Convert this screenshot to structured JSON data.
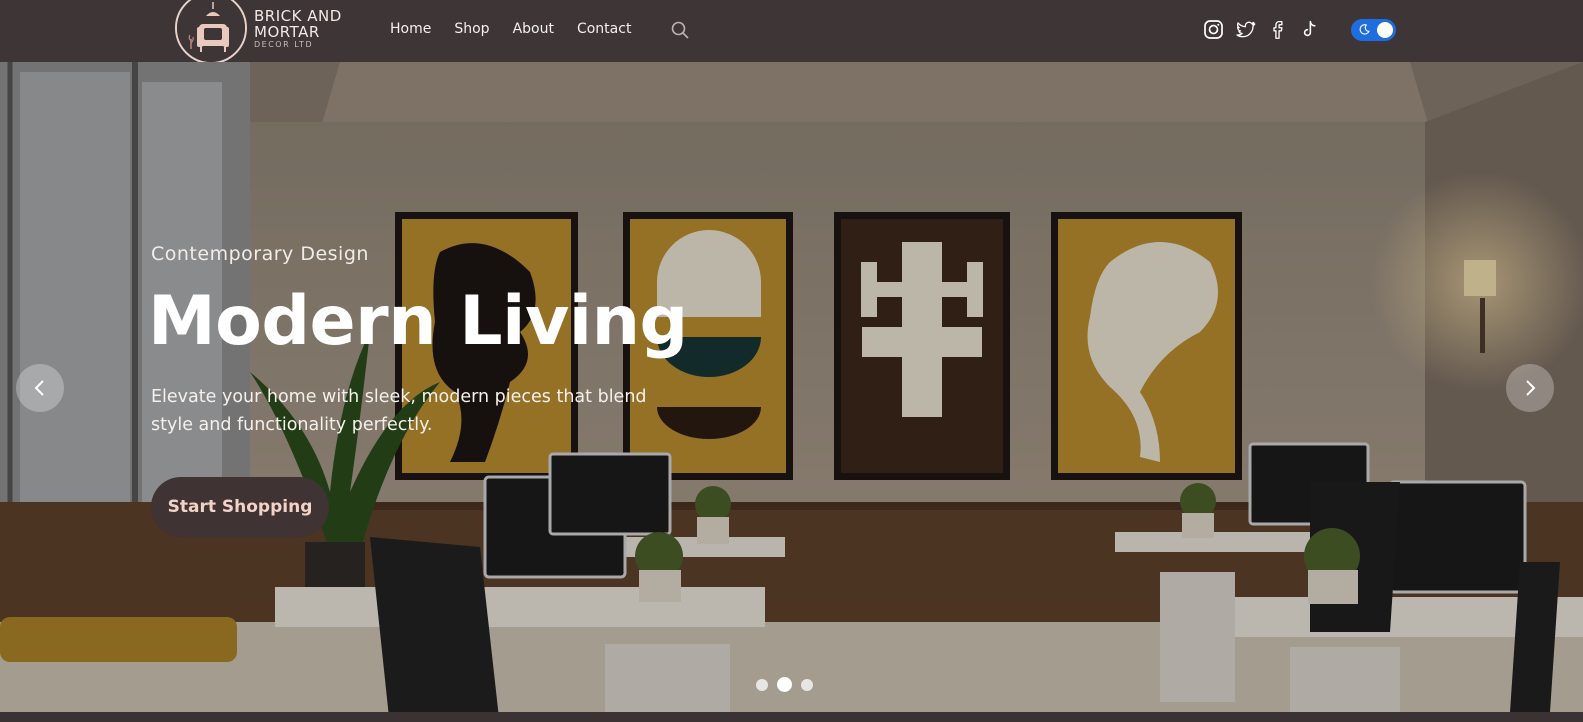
{
  "brand": {
    "line1": "BRICK AND",
    "line2": "MORTAR",
    "line3": "DECOR LTD"
  },
  "nav": {
    "links": [
      {
        "label": "Home"
      },
      {
        "label": "Shop"
      },
      {
        "label": "About"
      },
      {
        "label": "Contact"
      }
    ],
    "search_icon": "search-icon"
  },
  "social": [
    "instagram-icon",
    "twitter-icon",
    "facebook-icon",
    "tiktok-icon"
  ],
  "theme_toggle": {
    "state": "on",
    "icon": "moon-icon",
    "color": "#1e6ee0"
  },
  "hero": {
    "eyebrow": "Contemporary Design",
    "headline": "Modern Living",
    "subtext": "Elevate your home with sleek, modern pieces that blend style and functionality perfectly.",
    "cta_label": "Start Shopping",
    "active_slide": 2,
    "slide_count": 3
  },
  "colors": {
    "navbar": "#3d3536",
    "cta_bg": "#3f3334",
    "cta_text": "#f3d3c6",
    "accent": "#1e6ee0"
  }
}
